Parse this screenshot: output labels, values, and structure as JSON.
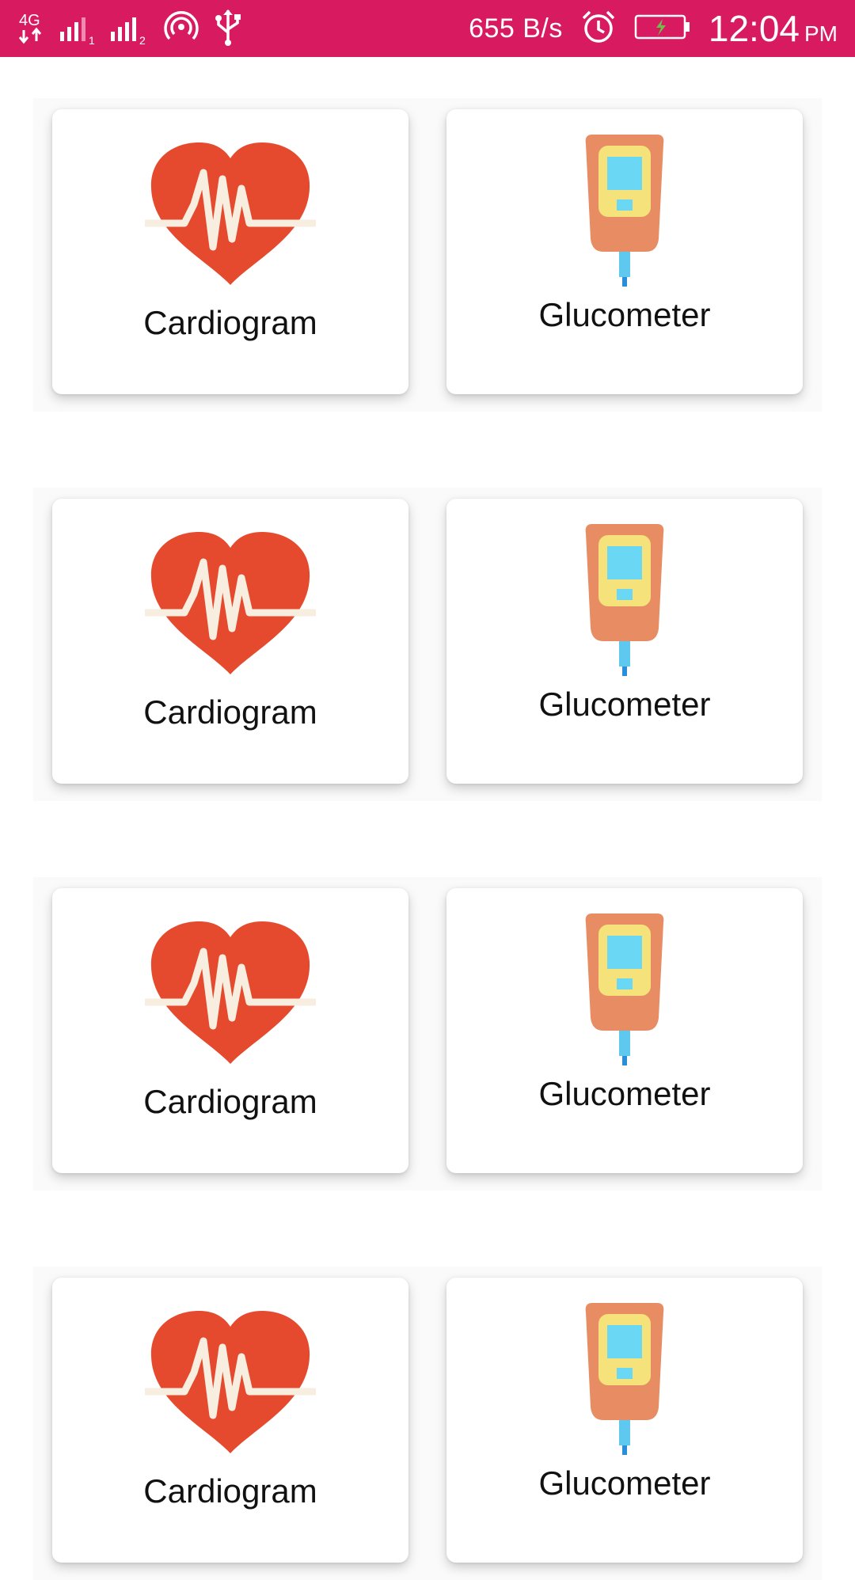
{
  "status_bar": {
    "network_label": "4G",
    "sim1_index": "1",
    "sim2_index": "2",
    "speed": "655 B/s",
    "time": "12:04",
    "ampm": "PM",
    "background_color": "#d81b60"
  },
  "icons": {
    "heart_color": "#e64a2e",
    "pulse_color": "#f7eedf",
    "meter_body_color": "#e88c63",
    "meter_frame_color": "#f5e27a",
    "meter_screen_color": "#6ad8f5",
    "strip_color": "#5ec8ef"
  },
  "grid": {
    "rows": [
      {
        "left": {
          "label": "Cardiogram",
          "icon": "heart-pulse-icon"
        },
        "right": {
          "label": "Glucometer",
          "icon": "glucometer-icon"
        }
      },
      {
        "left": {
          "label": "Cardiogram",
          "icon": "heart-pulse-icon"
        },
        "right": {
          "label": "Glucometer",
          "icon": "glucometer-icon"
        }
      },
      {
        "left": {
          "label": "Cardiogram",
          "icon": "heart-pulse-icon"
        },
        "right": {
          "label": "Glucometer",
          "icon": "glucometer-icon"
        }
      },
      {
        "left": {
          "label": "Cardiogram",
          "icon": "heart-pulse-icon"
        },
        "right": {
          "label": "Glucometer",
          "icon": "glucometer-icon"
        }
      }
    ]
  }
}
